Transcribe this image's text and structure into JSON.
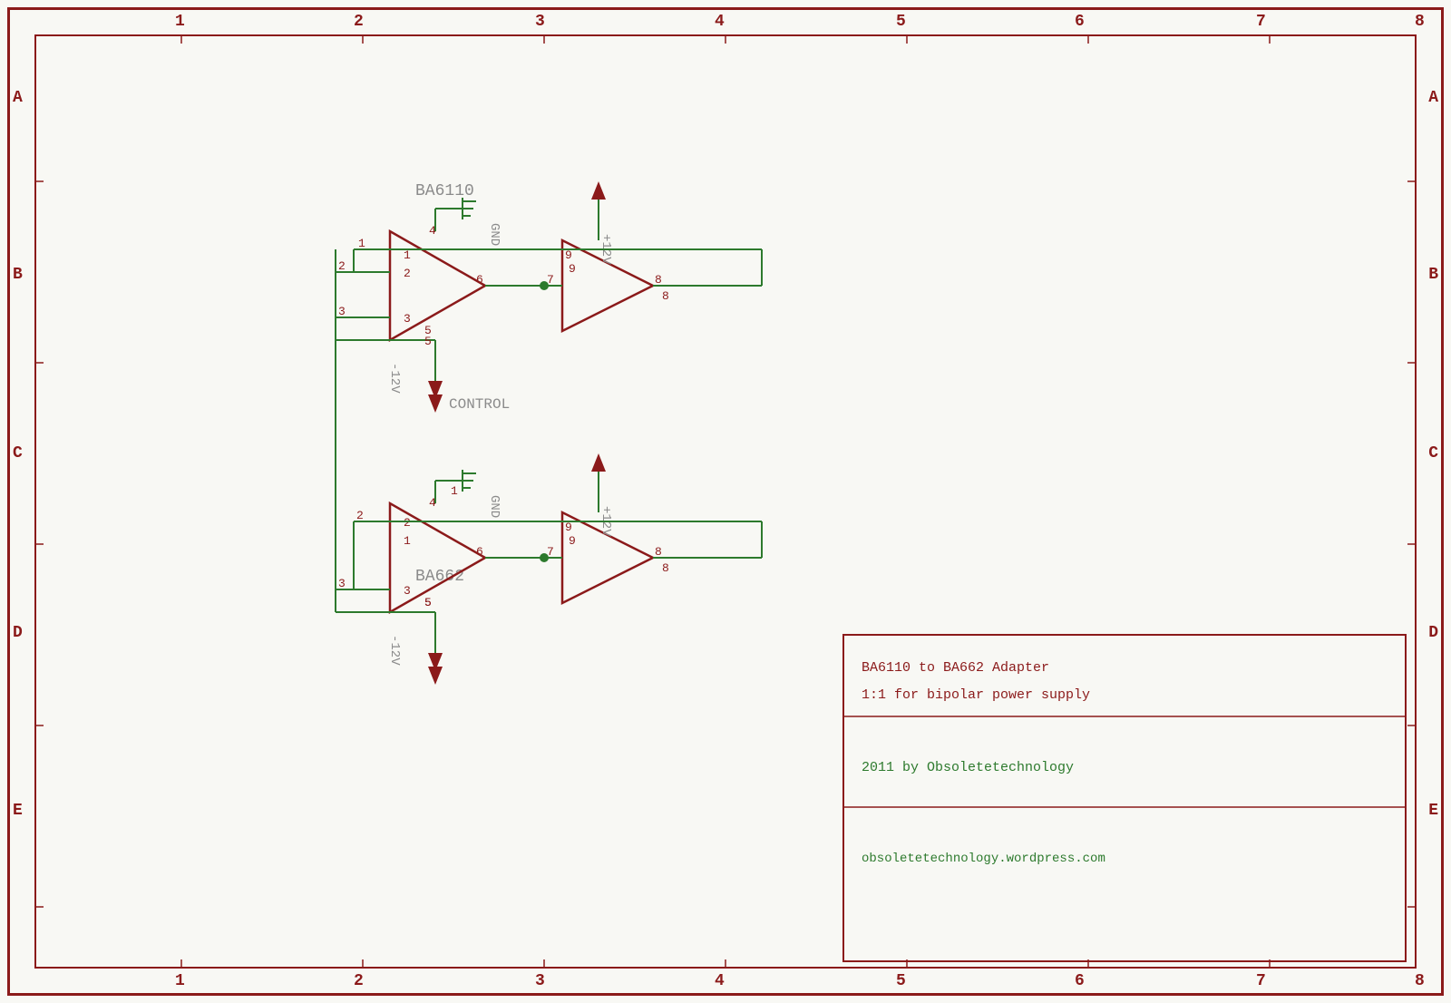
{
  "schematic": {
    "title": "BA6110 to BA662 Adapter",
    "subtitle": "1:1 for bipolar power supply",
    "year": "2011 by Obsoletetechnology",
    "website": "obsoletetechnology.wordpress.com",
    "grid_cols": [
      "1",
      "2",
      "3",
      "4",
      "5",
      "6",
      "7",
      "8"
    ],
    "grid_rows": [
      "A",
      "B",
      "C",
      "D",
      "E"
    ],
    "component_labels": {
      "ba6110": "BA6110",
      "ba662": "BA662",
      "gnd": "GND",
      "plus12v": "+12V",
      "minus12v": "-12V",
      "control": "CONTROL"
    }
  }
}
